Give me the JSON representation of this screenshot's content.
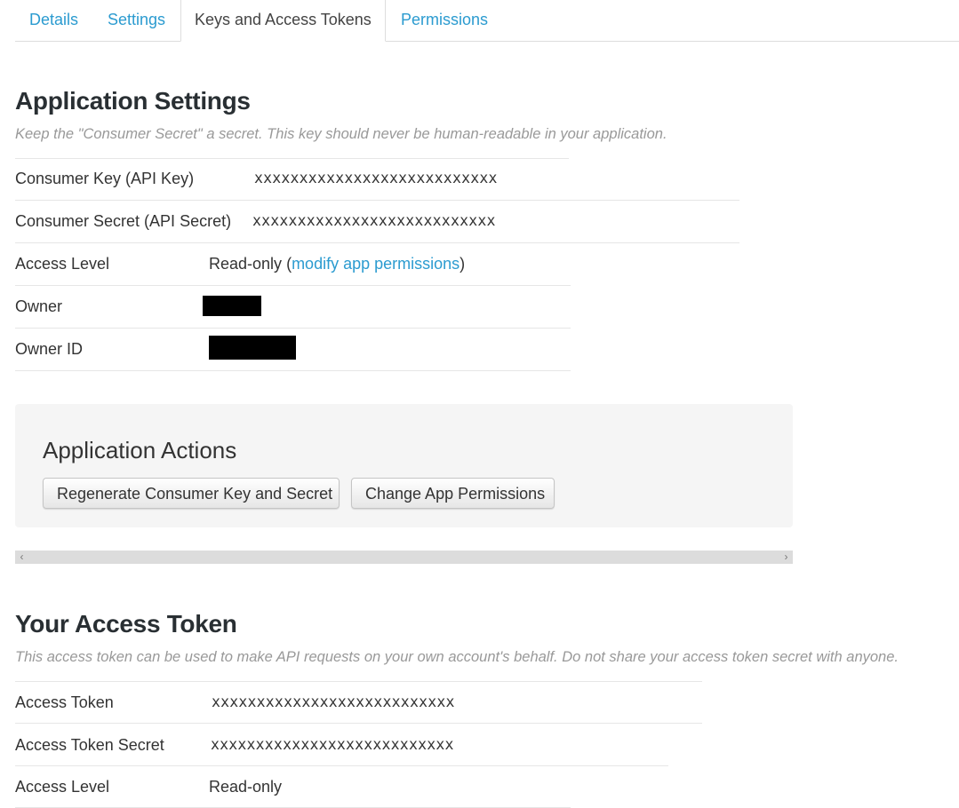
{
  "tabs": [
    {
      "label": "Details",
      "active": false
    },
    {
      "label": "Settings",
      "active": false
    },
    {
      "label": "Keys and Access Tokens",
      "active": true
    },
    {
      "label": "Permissions",
      "active": false
    }
  ],
  "app_settings": {
    "title": "Application Settings",
    "description": "Keep the \"Consumer Secret\" a secret. This key should never be human-readable in your application.",
    "consumer_key": {
      "label": "Consumer Key (API Key)",
      "value": "xxxxxxxxxxxxxxxxxxxxxxxxxxx"
    },
    "consumer_secret": {
      "label": "Consumer Secret (API Secret)",
      "value": "xxxxxxxxxxxxxxxxxxxxxxxxxxx"
    },
    "access_level": {
      "label": "Access Level",
      "value": "Read-only",
      "open": "(",
      "link": "modify app permissions",
      "close": ")"
    },
    "owner": {
      "label": "Owner"
    },
    "owner_id": {
      "label": "Owner ID"
    }
  },
  "app_actions": {
    "title": "Application Actions",
    "regenerate_label": "Regenerate Consumer Key and Secret",
    "change_permissions_label": "Change App Permissions"
  },
  "scrollbar": {
    "left_arrow": "‹",
    "right_arrow": "›"
  },
  "access_token": {
    "title": "Your Access Token",
    "description": "This access token can be used to make API requests on your own account's behalf. Do not share your access token secret with anyone.",
    "token": {
      "label": "Access Token",
      "value": "xxxxxxxxxxxxxxxxxxxxxxxxxxx"
    },
    "token_secret": {
      "label": "Access Token Secret",
      "value": "xxxxxxxxxxxxxxxxxxxxxxxxxxx"
    },
    "access_level": {
      "label": "Access Level",
      "value": "Read-only"
    }
  }
}
